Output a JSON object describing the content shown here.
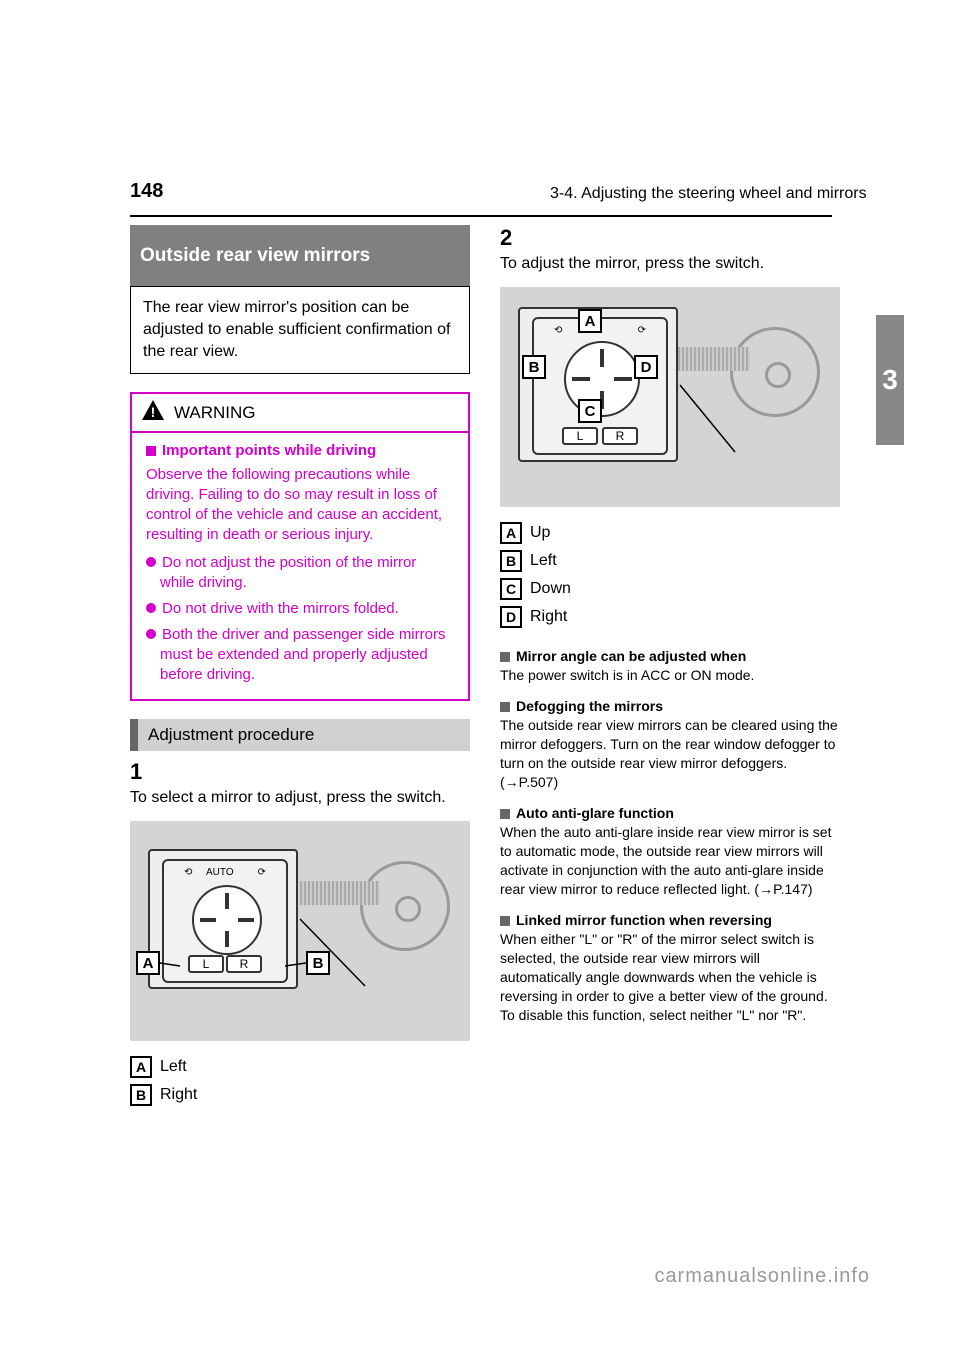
{
  "header": {
    "page_number": "148",
    "chapter": "3-4. Adjusting the steering wheel and mirrors"
  },
  "sidebar_tab": "3",
  "section_title": "Outside rear view mirrors",
  "intro": "The rear view mirror's position can be adjusted to enable sufficient confirmation of the rear view.",
  "warning": {
    "label": "WARNING",
    "heading": "Important points while driving",
    "heading_body": "Observe the following precautions while driving. Failing to do so may result in loss of control of the vehicle and cause an accident, resulting in death or serious injury.",
    "bullets": [
      "Do not adjust the position of the mirror while driving.",
      "Do not drive with the mirrors folded.",
      "Both the driver and passenger side mirrors must be extended and properly adjusted before driving."
    ]
  },
  "procedure_title": "Adjustment procedure",
  "step1": {
    "num": "1",
    "text": "To select a mirror to adjust, press the switch.",
    "legend": {
      "A": "Left",
      "B": "Right"
    },
    "switch_labels": {
      "auto": "AUTO",
      "L": "L",
      "R": "R"
    }
  },
  "step2": {
    "num": "2",
    "text": "To adjust the mirror, press the switch.",
    "legend": {
      "A": "Up",
      "B": "Left",
      "C": "Down",
      "D": "Right"
    },
    "switch_labels": {
      "L": "L",
      "R": "R"
    }
  },
  "notes": {
    "n1_title": "Mirror angle can be adjusted when",
    "n1_body": "The power switch is in ACC or ON mode.",
    "n2_title": "Defogging the mirrors",
    "n2_body": "The outside rear view mirrors can be cleared using the mirror defoggers. Turn on the rear window defogger to turn on the outside rear view mirror defoggers. (→P.507)",
    "n3_title": "Auto anti-glare function",
    "n3_body": "When the auto anti-glare inside rear view mirror is set to automatic mode, the outside rear view mirrors will activate in conjunction with the auto anti-glare inside rear view mirror to reduce reflected light. (→P.147)",
    "n4_title": "Linked mirror function when reversing",
    "n4_body": "When either \"L\" or \"R\" of the mirror select switch is selected, the outside rear view mirrors will automatically angle downwards when the vehicle is reversing in order to give a better view of the ground. To disable this function, select neither \"L\" nor \"R\"."
  },
  "watermark": "carmanualsonline.info"
}
